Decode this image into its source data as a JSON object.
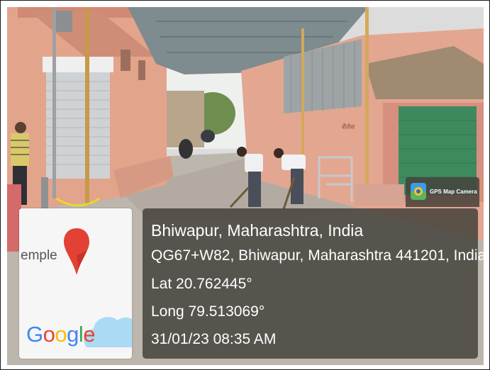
{
  "image": {
    "subject": "Two people sweeping a paved courtyard in front of a salmon-coloured building under a metal canopy roof",
    "wall_sign": "शैलेश"
  },
  "map_card": {
    "place_fragment": "emple",
    "logo_text": "Google",
    "logo_letters": [
      {
        "ch": "G",
        "color": "#4285F4"
      },
      {
        "ch": "o",
        "color": "#EA4335"
      },
      {
        "ch": "o",
        "color": "#FBBC05"
      },
      {
        "ch": "g",
        "color": "#4285F4"
      },
      {
        "ch": "l",
        "color": "#34A853"
      },
      {
        "ch": "e",
        "color": "#EA4335"
      }
    ],
    "pin_icon": "map-pin-icon",
    "pin_color": "#E34133"
  },
  "badge": {
    "icon": "gps-map-camera-icon",
    "label": "GPS Map Camera"
  },
  "location": {
    "title": "Bhiwapur, Maharashtra, India",
    "address": "QG67+W82, Bhiwapur, Maharashtra 441201, India",
    "latitude": "Lat 20.762445°",
    "longitude": "Long 79.513069°",
    "datetime": "31/01/23 08:35 AM"
  }
}
